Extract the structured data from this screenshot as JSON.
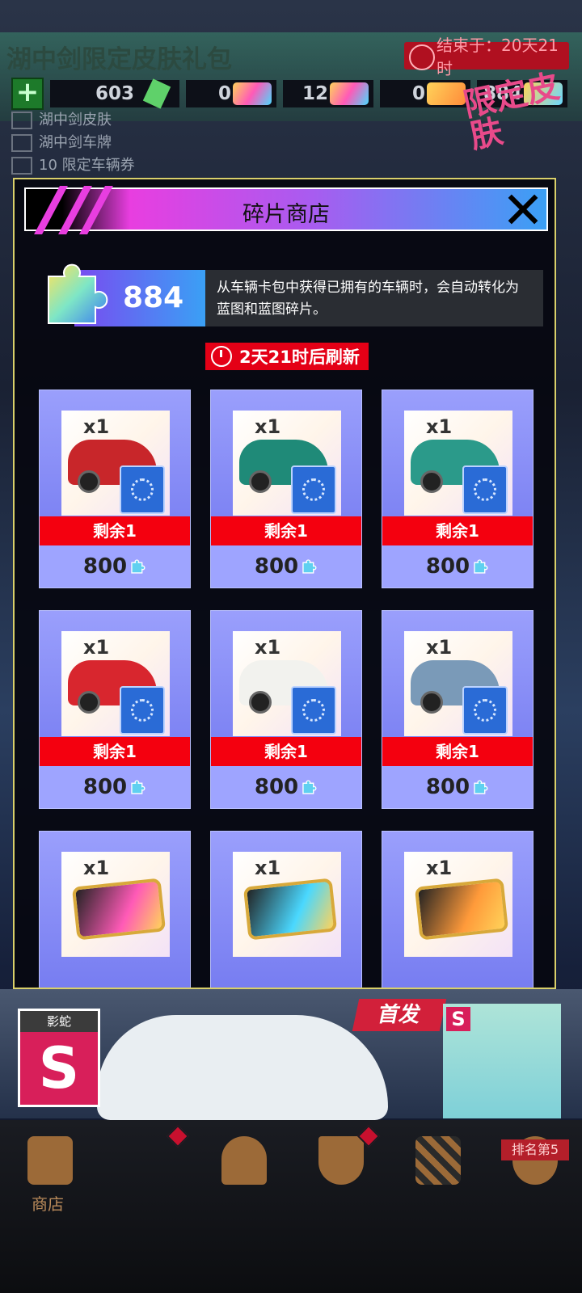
{
  "background": {
    "title": "湖中剑限定皮肤礼包",
    "timer": "结束于：20天21时",
    "currencies": [
      "603",
      "0",
      "12",
      "0",
      "884"
    ],
    "list": [
      "湖中剑皮肤",
      "湖中剑车牌",
      "10 限定车辆券"
    ],
    "badge": "限定皮肤",
    "launch_label": "首发",
    "car_class": "S",
    "car_class_label": "影蛇",
    "side_class": "S"
  },
  "modal": {
    "title": "碎片商店",
    "piece_count": "884",
    "description": "从车辆卡包中获得已拥有的车辆时，会自动转化为蓝图和蓝图碎片。",
    "refresh": "2天21时后刷新",
    "items": [
      {
        "qty": "x1",
        "remain": "剩余1",
        "price": "800",
        "kind": "car",
        "color": "#c8262a"
      },
      {
        "qty": "x1",
        "remain": "剩余1",
        "price": "800",
        "kind": "car",
        "color": "#1f8a78"
      },
      {
        "qty": "x1",
        "remain": "剩余1",
        "price": "800",
        "kind": "car",
        "color": "#2b9a8a"
      },
      {
        "qty": "x1",
        "remain": "剩余1",
        "price": "800",
        "kind": "car",
        "color": "#d8262e"
      },
      {
        "qty": "x1",
        "remain": "剩余1",
        "price": "800",
        "kind": "car",
        "color": "#f2f2ee"
      },
      {
        "qty": "x1",
        "remain": "剩余1",
        "price": "800",
        "kind": "car",
        "color": "#7a9ab8"
      },
      {
        "qty": "x1",
        "kind": "ticket",
        "color": "#ff5ab7"
      },
      {
        "qty": "x1",
        "kind": "ticket",
        "color": "#4ad8ff"
      },
      {
        "qty": "x1",
        "kind": "ticket",
        "color": "#ff9a3a"
      }
    ]
  },
  "nav": {
    "items": [
      {
        "label": "商店",
        "icon": "shop-icon"
      },
      {
        "label": "",
        "icon": "garage-icon"
      },
      {
        "label": "",
        "icon": "trophy-icon"
      },
      {
        "label": "",
        "icon": "race-flags-icon"
      },
      {
        "label": "",
        "icon": "helmet-icon"
      }
    ],
    "rank": "排名第5"
  }
}
